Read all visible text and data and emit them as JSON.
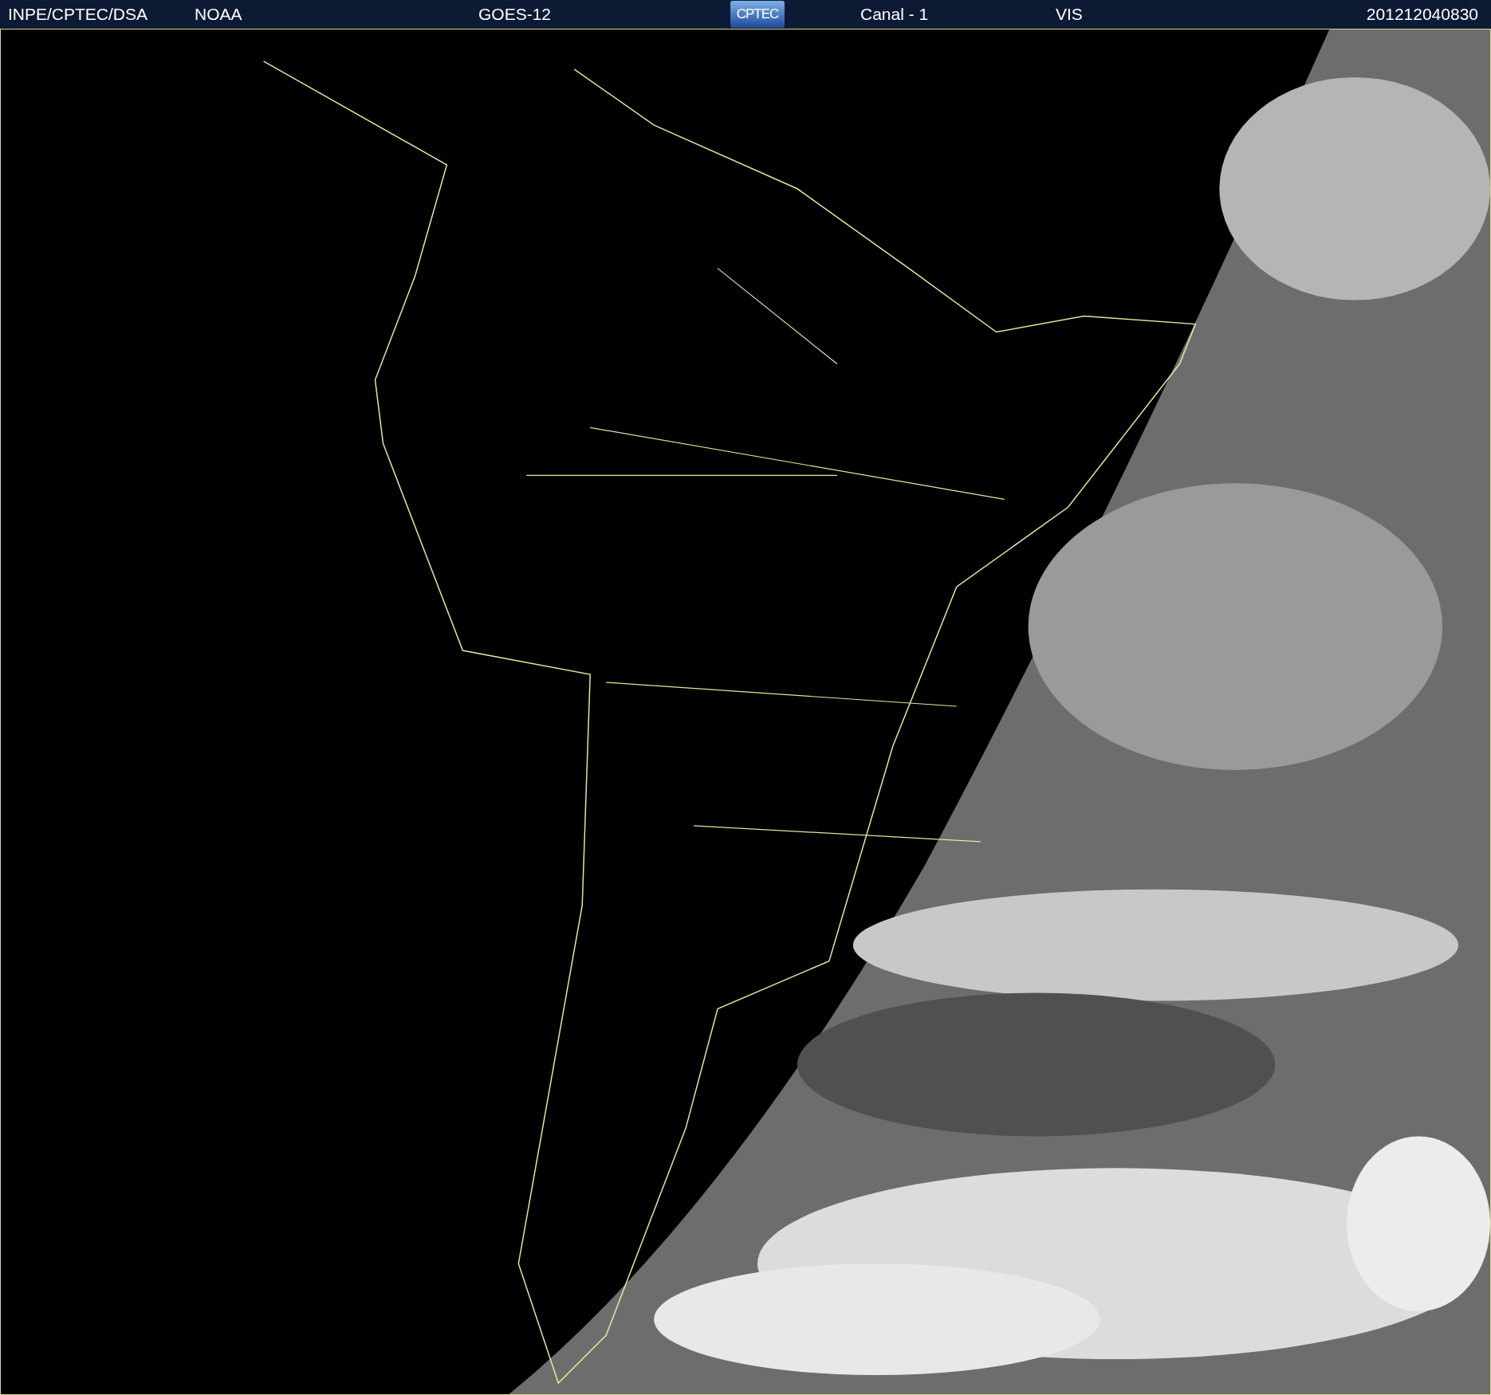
{
  "header": {
    "agency": "INPE/CPTEC/DSA",
    "source": "NOAA",
    "satellite": "GOES-12",
    "logo": "CPTEC",
    "channel": "Canal - 1",
    "band": "VIS",
    "timestamp": "201212040830"
  }
}
